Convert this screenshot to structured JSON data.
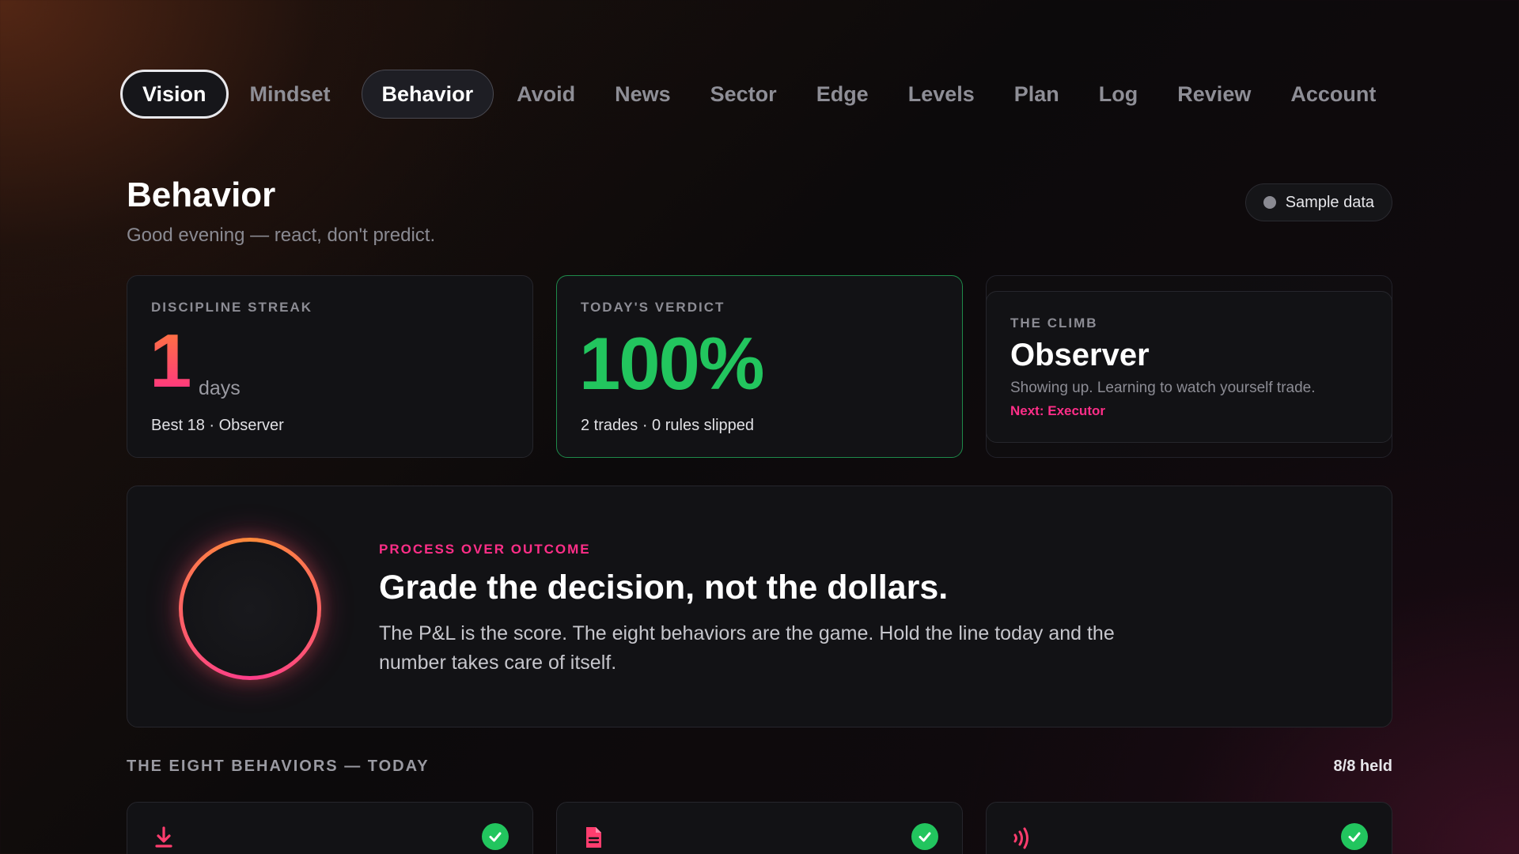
{
  "nav": {
    "tabs": [
      {
        "label": "Vision"
      },
      {
        "label": "Mindset"
      },
      {
        "label": "Behavior"
      },
      {
        "label": "Avoid"
      },
      {
        "label": "News"
      },
      {
        "label": "Sector"
      },
      {
        "label": "Edge"
      },
      {
        "label": "Levels"
      },
      {
        "label": "Plan"
      },
      {
        "label": "Log"
      },
      {
        "label": "Review"
      },
      {
        "label": "Account"
      }
    ],
    "active": "Behavior"
  },
  "header": {
    "title": "Behavior",
    "subtitle": "Good evening — react, don't predict.",
    "sample_label": "Sample data"
  },
  "streak": {
    "label": "DISCIPLINE STREAK",
    "value": "1",
    "unit": "days",
    "best": "Best 18 · Observer"
  },
  "verdict": {
    "label": "TODAY'S VERDICT",
    "value": "100%",
    "summary": "2 trades · 0 rules slipped"
  },
  "climb": {
    "label": "THE CLIMB",
    "rank": "Observer",
    "description": "Showing up. Learning to watch yourself trade.",
    "next": "Next: Executor"
  },
  "banner": {
    "label": "PROCESS OVER OUTCOME",
    "headline": "Grade the decision, not the dollars.",
    "body": "The P&L is the score. The eight behaviors are the game. Hold the line today and the number takes care of itself."
  },
  "behaviors": {
    "section_label": "THE EIGHT BEHAVIORS — TODAY",
    "held": "8/8 held",
    "items": [
      {
        "icon": "download-icon",
        "held": true
      },
      {
        "icon": "document-icon",
        "held": true
      },
      {
        "icon": "signal-waves-icon",
        "held": true
      }
    ]
  },
  "colors": {
    "accent_pink": "#ff2e88",
    "accent_orange": "#ff7a3a",
    "success_green": "#22c55e"
  }
}
